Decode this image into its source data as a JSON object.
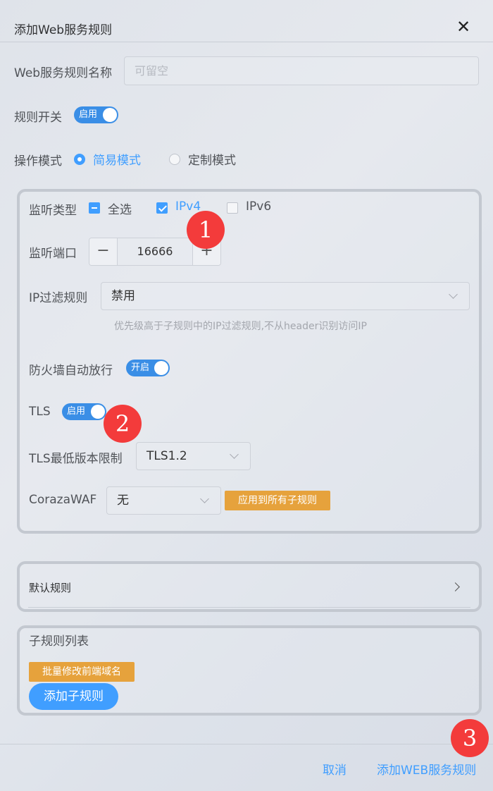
{
  "dialog": {
    "title": "添加Web服务规则",
    "close_symbol": "✕"
  },
  "form": {
    "name_label": "Web服务规则名称",
    "name_placeholder": "可留空",
    "name_value": "",
    "switch_label": "规则开关",
    "switch_text": "启用",
    "switch_on": true,
    "mode_label": "操作模式",
    "mode_options": [
      {
        "label": "简易模式",
        "selected": true
      },
      {
        "label": "定制模式",
        "selected": false
      }
    ]
  },
  "listen": {
    "type_label": "监听类型",
    "type_options": [
      {
        "label": "全选",
        "state": "indeterminate"
      },
      {
        "label": "IPv4",
        "state": "checked"
      },
      {
        "label": "IPv6",
        "state": "unchecked"
      }
    ],
    "port_label": "监听端口",
    "port_value": "16666",
    "minus_symbol": "−",
    "plus_symbol": "+",
    "ip_filter_label": "IP过滤规则",
    "ip_filter_value": "禁用",
    "ip_filter_hint": "优先级高于子规则中的IP过滤规则,不从header识别访问IP",
    "firewall_label": "防火墙自动放行",
    "firewall_switch_text": "开启",
    "tls_label": "TLS",
    "tls_switch_text": "启用",
    "tls_min_label": "TLS最低版本限制",
    "tls_min_value": "TLS1.2",
    "waf_label": "CorazaWAF",
    "waf_value": "无",
    "waf_apply_button": "应用到所有子规则"
  },
  "default_rule": {
    "title": "默认规则"
  },
  "sub_rules": {
    "title": "子规则列表",
    "batch_button": "批量修改前端域名",
    "add_button": "添加子规则"
  },
  "footer": {
    "cancel_button": "取消",
    "submit_button": "添加WEB服务规则"
  },
  "annotations": [
    "1",
    "2",
    "3"
  ],
  "colors": {
    "primary": "#409eff",
    "warning": "#e6a23c",
    "badge": "#f33b3b",
    "switch": "#3a8ee6"
  }
}
